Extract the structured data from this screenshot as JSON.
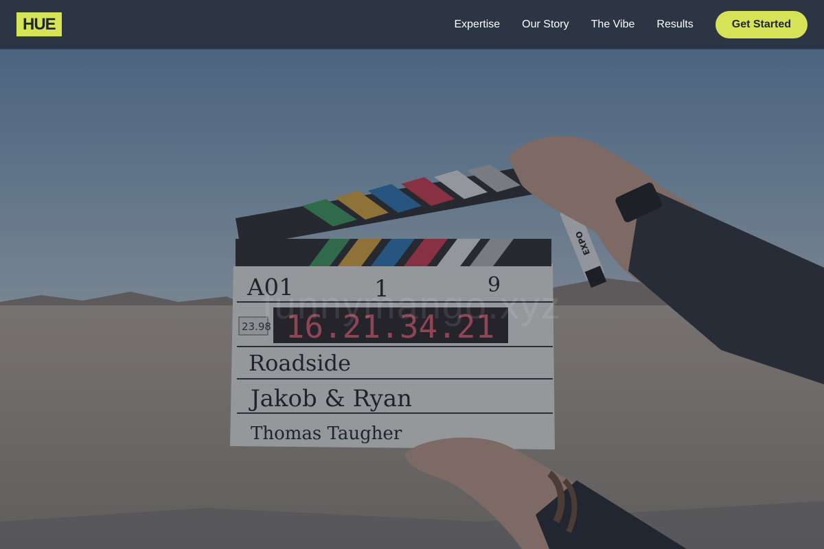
{
  "brand": {
    "logo_text": "HUE",
    "accent_color": "#d6e356",
    "nav_bg": "#2b3544"
  },
  "nav": {
    "links": [
      {
        "label": "Expertise"
      },
      {
        "label": "Our Story"
      },
      {
        "label": "The Vibe"
      },
      {
        "label": "Results"
      }
    ],
    "cta_label": "Get Started"
  },
  "hero": {
    "watermark": "funnymango.xyz",
    "slate": {
      "roll": "A01",
      "scene": "1",
      "take": "9",
      "fps": "23.98",
      "timecode": "16.21.34.21",
      "prod": "Roadside",
      "dir": "Jakob & Ryan",
      "cam": "Thomas Taugher",
      "marker_brand": "EXPO"
    }
  }
}
